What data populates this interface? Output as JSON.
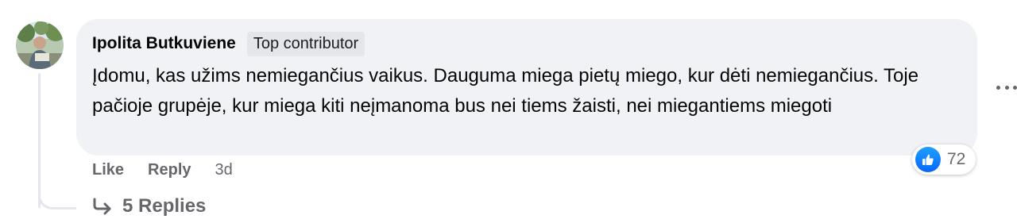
{
  "comment": {
    "author": "Ipolita Butkuviene",
    "badge": "Top contributor",
    "text": "Įdomu, kas užims nemiegančius vaikus. Dauguma miega pietų miego, kur dėti nemiegančius. Toje pačioje grupėje, kur miega kiti neįmanoma bus nei tiems žaisti, nei miegantiems miegoti",
    "actions": {
      "like": "Like",
      "reply": "Reply",
      "time": "3d"
    },
    "reactions": {
      "icon": "thumbs-up-icon",
      "count": "72",
      "color": "#0866ff"
    },
    "replies_label": "5 Replies"
  },
  "colors": {
    "bubble": "#f0f2f5",
    "muted": "#65676b",
    "text": "#050505",
    "line": "#e4e6eb"
  }
}
